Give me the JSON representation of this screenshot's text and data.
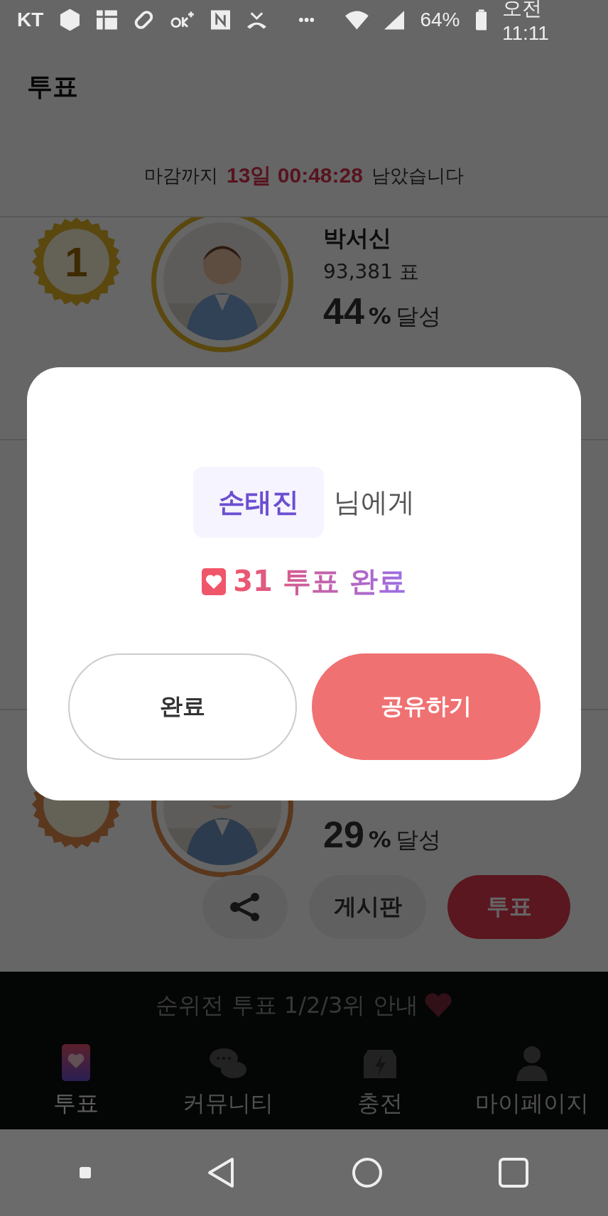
{
  "status_bar": {
    "carrier": "KT",
    "battery": "64%",
    "time": "오전 11:11"
  },
  "header": {
    "title": "투표"
  },
  "countdown": {
    "prefix": "마감까지",
    "remaining": "13일 00:48:28",
    "suffix": "남았습니다"
  },
  "candidates": [
    {
      "rank": "1",
      "kind": "gold",
      "name": "박서신",
      "votes": "93,381 표",
      "percent": "44",
      "unit": "%",
      "achieved": "달성"
    },
    {
      "kind": "bronze",
      "percent": "29",
      "unit": "%",
      "achieved": "달성",
      "board": "게시판",
      "vote": "투표"
    }
  ],
  "banner": {
    "title": "순위전 투표 1/2/3위 안내"
  },
  "tab_bar": [
    {
      "label": "투표",
      "kind": "vote",
      "selected": true
    },
    {
      "label": "커뮤니티",
      "kind": "chat",
      "selected": false
    },
    {
      "label": "충전",
      "kind": "charge",
      "selected": false
    },
    {
      "label": "마이페이지",
      "kind": "user",
      "selected": false
    }
  ],
  "dialog": {
    "recipient": "손태진",
    "recipient_suffix": "님에게",
    "result": "31 투표 완료",
    "buttons": [
      {
        "label": "완료",
        "kind": "outline"
      },
      {
        "label": "공유하기",
        "kind": "primary"
      }
    ]
  }
}
